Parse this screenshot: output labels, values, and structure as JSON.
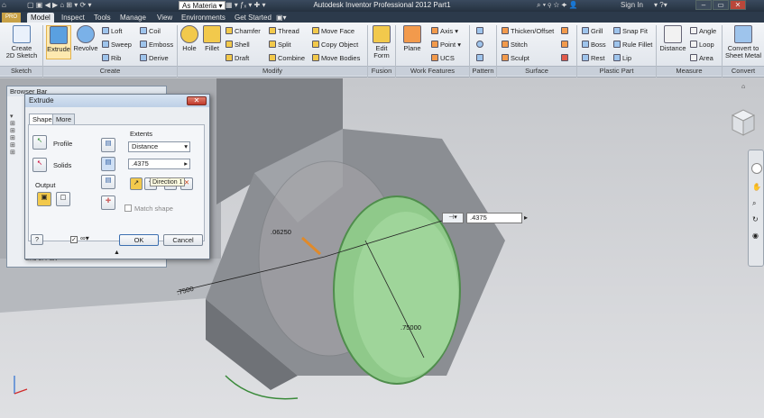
{
  "titlebar": {
    "title": "Autodesk Inventor Professional 2012",
    "doc": "Part1",
    "material": "As Materia",
    "sign_in": "Sign In",
    "help_icon": "help-icon"
  },
  "tabs": [
    "Model",
    "Inspect",
    "Tools",
    "Manage",
    "View",
    "Environments",
    "Get Started"
  ],
  "active_tab": "Model",
  "ribbon": {
    "sketch": {
      "group": "Sketch",
      "create_2d_sketch": "Create\n2D Sketch"
    },
    "create": {
      "group": "Create",
      "extrude": "Extrude",
      "revolve": "Revolve",
      "loft": "Loft",
      "sweep": "Sweep",
      "rib": "Rib",
      "coil": "Coil",
      "emboss": "Emboss",
      "derive": "Derive"
    },
    "modify": {
      "group": "Modify",
      "hole": "Hole",
      "fillet": "Fillet",
      "chamfer": "Chamfer",
      "shell": "Shell",
      "draft": "Draft",
      "thread": "Thread",
      "split": "Split",
      "combine": "Combine",
      "move_face": "Move Face",
      "copy_object": "Copy Object",
      "move_bodies": "Move Bodies"
    },
    "fusion": {
      "group": "Fusion",
      "edit_form": "Edit\nForm"
    },
    "work_features": {
      "group": "Work Features",
      "plane": "Plane",
      "axis": "Axis",
      "point": "Point",
      "ucs": "UCS"
    },
    "pattern": {
      "group": "Pattern"
    },
    "surface": {
      "group": "Surface",
      "thicken_offset": "Thicken/Offset",
      "stitch": "Stitch",
      "sculpt": "Sculpt"
    },
    "plastic_part": {
      "group": "Plastic Part",
      "grill": "Grill",
      "boss": "Boss",
      "rest": "Rest",
      "snap_fit": "Snap Fit",
      "rule_fillet": "Rule Fillet",
      "lip": "Lip"
    },
    "measure": {
      "group": "Measure",
      "distance": "Distance",
      "angle": "Angle",
      "loop": "Loop",
      "area": "Area"
    },
    "convert": {
      "group": "Convert",
      "convert_to_sheet_metal": "Convert to\nSheet Metal"
    }
  },
  "browser": {
    "title": "Browser Bar",
    "bottom_label": "End of Part"
  },
  "dialog": {
    "title": "Extrude",
    "tabs": [
      "Shape",
      "More"
    ],
    "profile_label": "Profile",
    "solids_label": "Solids",
    "output_label": "Output",
    "extents_label": "Extents",
    "extents_value": "Distance",
    "distance_value": ".4375",
    "direction_tooltip": "Direction 1",
    "match_shape_label": "Match shape",
    "ok_label": "OK",
    "cancel_label": "Cancel"
  },
  "viewport": {
    "dimension_input": ".4375",
    "annotations": [
      ".06250",
      ".75000",
      ".7500"
    ]
  },
  "colors": {
    "accent": "#3c6fb0",
    "face_green": "#8fc98a",
    "nut_gray": "#8c8f94",
    "dialog_bg": "#ebeef2"
  }
}
